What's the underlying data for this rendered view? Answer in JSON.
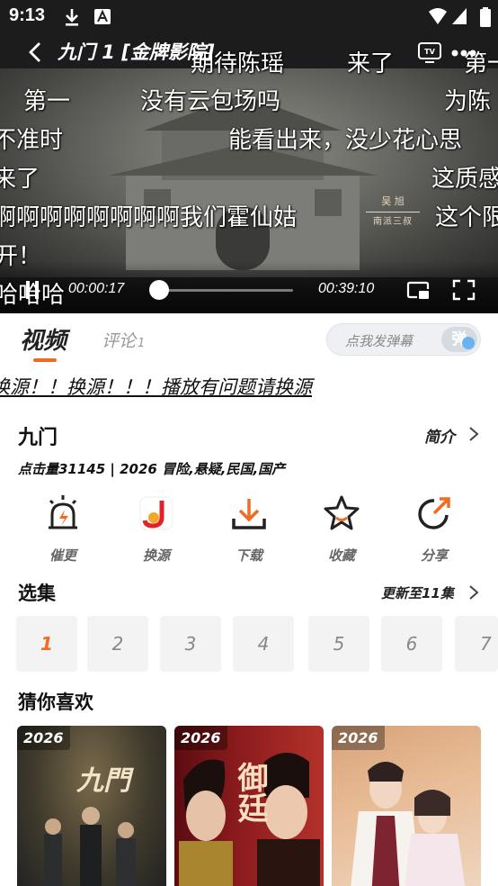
{
  "status_bar": {
    "time": "9:13"
  },
  "player": {
    "title": "九门 1 [金牌影院]",
    "current_time": "00:00:17",
    "total_time": "00:39:10",
    "progress": 0.007,
    "seal_lines": [
      "吴 旭",
      "南派三叔"
    ],
    "danmaku": [
      "期待陈瑶",
      "来了",
      "第一",
      "第一",
      "没有云包场吗",
      "为陈",
      "不准时",
      "能看出来，没少花心思",
      "来了",
      "这质感",
      "啊啊啊啊啊啊啊啊我们霍仙姑",
      "这个限",
      "开！",
      "哈哈哈"
    ]
  },
  "tabs": {
    "video_label": "视频",
    "comment_label": "评论",
    "comment_count": "1",
    "danmu_placeholder": "点我发弹幕",
    "danmu_button": "弹"
  },
  "notice": "换源！！换源！！！播放有问题请换源",
  "info": {
    "show_name": "九门",
    "intro_label": "简介",
    "meta": "点击量31145 | 2026 冒险,悬疑,民国,国产"
  },
  "actions": [
    {
      "label": "催更",
      "icon": "alarm-icon"
    },
    {
      "label": "换源",
      "icon": "switch-source-icon"
    },
    {
      "label": "下载",
      "icon": "download-icon"
    },
    {
      "label": "收藏",
      "icon": "star-icon"
    },
    {
      "label": "分享",
      "icon": "share-icon"
    }
  ],
  "episodes": {
    "title": "选集",
    "update_label": "更新至11集",
    "items": [
      "1",
      "2",
      "3",
      "4",
      "5",
      "6",
      "7"
    ],
    "active": "1"
  },
  "recommend": {
    "title": "猜你喜欢",
    "cards": [
      {
        "year": "2026",
        "poster_text": "九門"
      },
      {
        "year": "2026",
        "poster_text": "御廷"
      },
      {
        "year": "2026",
        "poster_text": ""
      }
    ]
  },
  "colors": {
    "accent": "#f26b21",
    "text": "#111111",
    "muted": "#888888"
  }
}
